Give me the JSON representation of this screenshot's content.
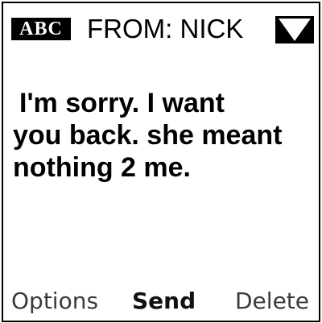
{
  "header": {
    "mode_label": "ABC",
    "from_text": "FROM: NICK",
    "message_icon": "envelope-icon"
  },
  "message": {
    "lines": [
      "I'm sorry. I want",
      "you back. she meant",
      "nothing 2 me."
    ]
  },
  "softkeys": {
    "left": "Options",
    "center": "Send",
    "right": "Delete"
  },
  "colors": {
    "background": "#ffffff",
    "foreground": "#000000"
  }
}
